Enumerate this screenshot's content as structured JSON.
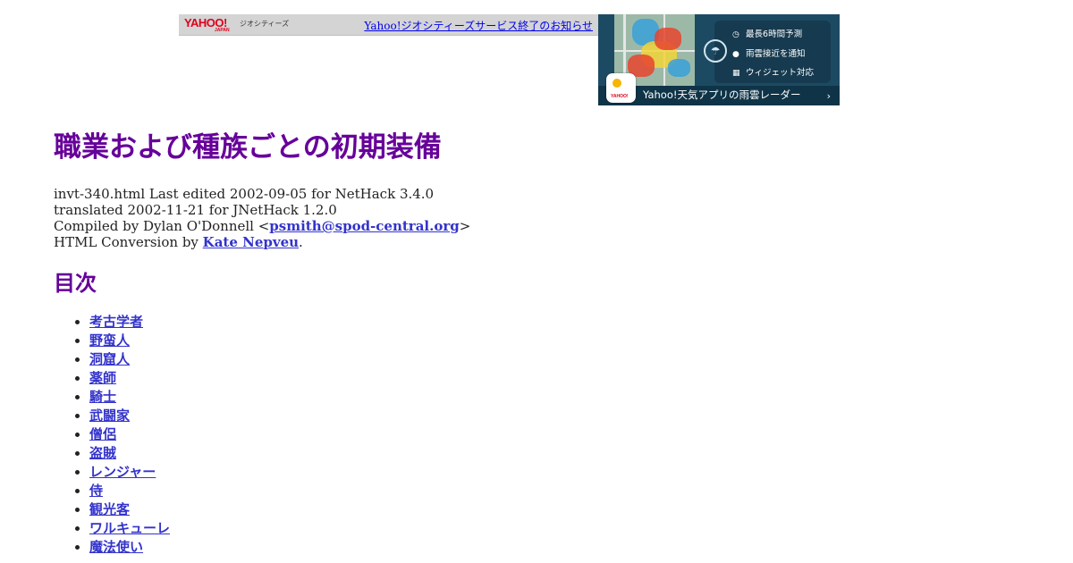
{
  "header_bar": {
    "logo": "YAHOO!",
    "logo_sub": "JAPAN",
    "service": "ジオシティーズ",
    "notice": "Yahoo!ジオシティーズサービス終了のお知らせ"
  },
  "weather_ad": {
    "features": [
      "最長6時間予測",
      "雨雲接近を通知",
      "ウィジェット対応"
    ],
    "feature_icons": [
      "clock-icon",
      "location-pin-icon",
      "widget-grid-icon"
    ],
    "app_brand": "YAHOO!",
    "title": "Yahoo!天気アプリの雨雲レーダー",
    "chevron": "›"
  },
  "page": {
    "title": "職業および種族ごとの初期装備",
    "meta": {
      "line1": "invt-340.html Last edited 2002-09-05 for NetHack 3.4.0",
      "line2": "translated 2002-11-21 for JNetHack 1.2.0",
      "compiled_prefix": "Compiled by Dylan O'Donnell <",
      "compiled_email": "psmith@spod-central.org",
      "compiled_suffix": ">",
      "conversion_prefix": "HTML Conversion by ",
      "conversion_name": "Kate Nepveu",
      "conversion_suffix": "."
    },
    "toc_heading": "目次",
    "toc": [
      "考古学者",
      "野蛮人",
      "洞窟人",
      "薬師",
      "騎士",
      "武闘家",
      "僧侶",
      "盗賊",
      "レンジャー",
      "侍",
      "観光客",
      "ワルキューレ",
      "魔法使い"
    ]
  },
  "colors": {
    "heading": "#660099",
    "link": "#3333cc",
    "notice_link": "#0000ee",
    "yahoo_red": "#e0001a"
  }
}
